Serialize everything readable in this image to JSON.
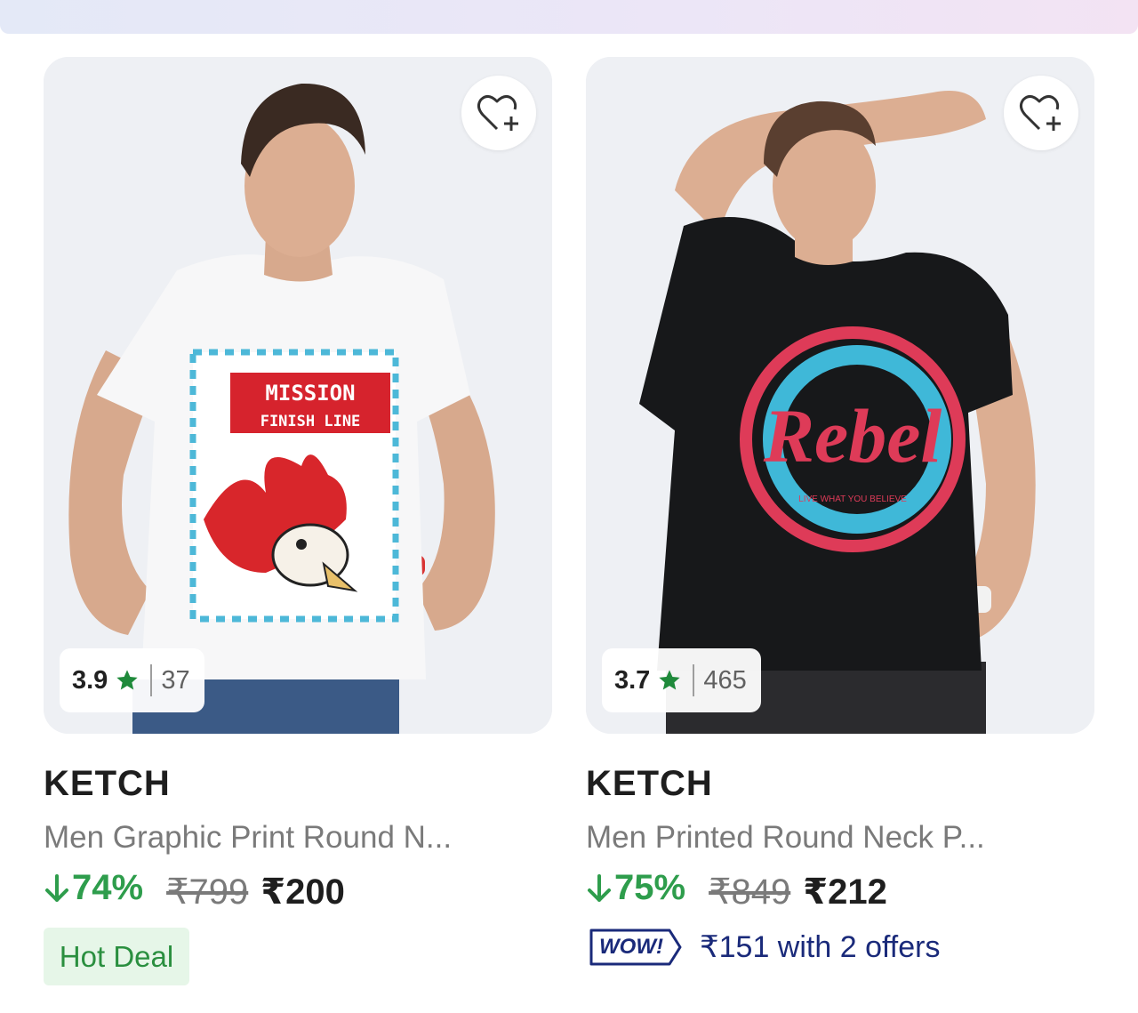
{
  "products": [
    {
      "image_alt": "Man in white graphic t-shirt",
      "shirt_print": {
        "line1": "MISSION",
        "line2": "FINISH LINE"
      },
      "rating": {
        "score": "3.9",
        "count": "37"
      },
      "brand": "KETCH",
      "title": "Men Graphic Print Round N...",
      "discount": "74%",
      "mrp": "₹799",
      "price": "₹200",
      "tag": "Hot Deal"
    },
    {
      "image_alt": "Man in black t-shirt",
      "shirt_print": {
        "word": "Rebel",
        "tagline": "LIVE WHAT YOU BELIEVE"
      },
      "rating": {
        "score": "3.7",
        "count": "465"
      },
      "brand": "KETCH",
      "title": "Men Printed Round Neck P...",
      "discount": "75%",
      "mrp": "₹849",
      "price": "₹212",
      "offer": {
        "badge": "WOW!",
        "text": "₹151 with 2 offers"
      }
    }
  ],
  "icons": {
    "wishlist": "heart-plus-icon",
    "rating": "star-icon",
    "discount": "arrow-down-icon"
  },
  "colors": {
    "discount_green": "#2e9d4c",
    "star_green": "#1f8a3b",
    "hot_deal_bg": "#e6f6e8",
    "offer_blue": "#1a2a7a"
  }
}
